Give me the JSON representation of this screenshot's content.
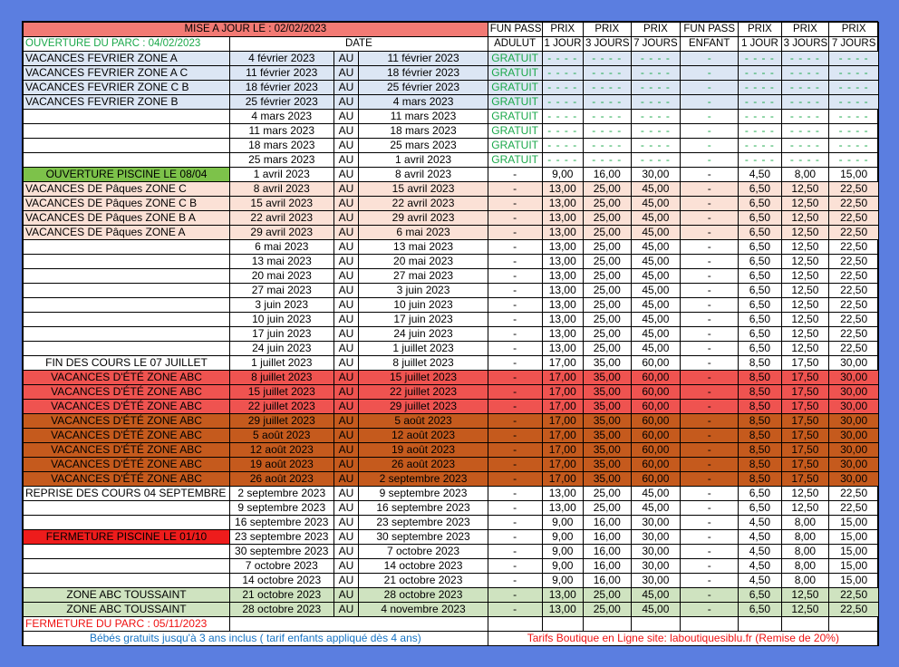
{
  "header": {
    "update_label": "MISE A JOUR LE : 02/02/2023",
    "opening_label": "OUVERTURE DU PARC : 04/02/2023",
    "date_label": "DATE",
    "cols": [
      {
        "top": "FUN PASS",
        "bottom": "ADULUT"
      },
      {
        "top": "PRIX",
        "bottom": "1 JOUR"
      },
      {
        "top": "PRIX",
        "bottom": "3 JOURS"
      },
      {
        "top": "PRIX",
        "bottom": "7 JOURS"
      },
      {
        "top": "FUN PASS",
        "bottom": "ENFANT"
      },
      {
        "top": "PRIX",
        "bottom": "1 JOUR"
      },
      {
        "top": "PRIX",
        "bottom": "3 JOURS"
      },
      {
        "top": "PRIX",
        "bottom": "7 JOURS"
      }
    ]
  },
  "rows": [
    {
      "label": "VACANCES FEVRIER ZONE A",
      "from": "4 février 2023",
      "au": "AU",
      "to": "11 février 2023",
      "fp_a": "GRATUIT",
      "a1": "- - - -",
      "a3": "- - - -",
      "a7": "- - - -",
      "fp_e": "-",
      "e1": "- - - -",
      "e3": "- - - -",
      "e7": "- - - -",
      "style": "lightblue"
    },
    {
      "label": "VACANCES FEVRIER ZONE A C",
      "from": "11 février 2023",
      "au": "AU",
      "to": "18 février 2023",
      "fp_a": "GRATUIT",
      "a1": "- - - -",
      "a3": "- - - -",
      "a7": "- - - -",
      "fp_e": "-",
      "e1": "- - - -",
      "e3": "- - - -",
      "e7": "- - - -",
      "style": "lightblue"
    },
    {
      "label": "VACANCES FEVRIER ZONE C B",
      "from": "18 février 2023",
      "au": "AU",
      "to": "25 février 2023",
      "fp_a": "GRATUIT",
      "a1": "- - - -",
      "a3": "- - - -",
      "a7": "- - - -",
      "fp_e": "-",
      "e1": "- - - -",
      "e3": "- - - -",
      "e7": "- - - -",
      "style": "lightblue"
    },
    {
      "label": "VACANCES FEVRIER ZONE B",
      "from": "25 février 2023",
      "au": "AU",
      "to": "4 mars 2023",
      "fp_a": "GRATUIT",
      "a1": "- - - -",
      "a3": "- - - -",
      "a7": "- - - -",
      "fp_e": "-",
      "e1": "- - - -",
      "e3": "- - - -",
      "e7": "- - - -",
      "style": "lightblue"
    },
    {
      "label": "",
      "from": "4 mars 2023",
      "au": "AU",
      "to": "11 mars 2023",
      "fp_a": "GRATUIT",
      "a1": "- - - -",
      "a3": "- - - -",
      "a7": "- - - -",
      "fp_e": "-",
      "e1": "- - - -",
      "e3": "- - - -",
      "e7": "- - - -",
      "style": "plain"
    },
    {
      "label": "",
      "from": "11 mars 2023",
      "au": "AU",
      "to": "18 mars 2023",
      "fp_a": "GRATUIT",
      "a1": "- - - -",
      "a3": "- - - -",
      "a7": "- - - -",
      "fp_e": "-",
      "e1": "- - - -",
      "e3": "- - - -",
      "e7": "- - - -",
      "style": "plain"
    },
    {
      "label": "",
      "from": "18 mars 2023",
      "au": "AU",
      "to": "25 mars 2023",
      "fp_a": "GRATUIT",
      "a1": "- - - -",
      "a3": "- - - -",
      "a7": "- - - -",
      "fp_e": "-",
      "e1": "- - - -",
      "e3": "- - - -",
      "e7": "- - - -",
      "style": "plain"
    },
    {
      "label": "",
      "from": "25 mars 2023",
      "au": "AU",
      "to": "1 avril 2023",
      "fp_a": "GRATUIT",
      "a1": "- - - -",
      "a3": "- - - -",
      "a7": "- - - -",
      "fp_e": "-",
      "e1": "- - - -",
      "e3": "- - - -",
      "e7": "- - - -",
      "style": "plain"
    },
    {
      "label": "OUVERTURE PISCINE LE 08/04",
      "from": "1 avril 2023",
      "au": "AU",
      "to": "8 avril 2023",
      "fp_a": "-",
      "a1": "9,00",
      "a3": "16,00",
      "a7": "30,00",
      "fp_e": "-",
      "e1": "4,50",
      "e3": "8,00",
      "e7": "15,00",
      "style": "plain",
      "label_style": "greenlabel"
    },
    {
      "label": "VACANCES DE Pâques ZONE C",
      "from": "8 avril 2023",
      "au": "AU",
      "to": "15 avril 2023",
      "fp_a": "-",
      "a1": "13,00",
      "a3": "25,00",
      "a7": "45,00",
      "fp_e": "-",
      "e1": "6,50",
      "e3": "12,50",
      "e7": "22,50",
      "style": "peach"
    },
    {
      "label": "VACANCES DE Pâques ZONE C B",
      "from": "15 avril 2023",
      "au": "AU",
      "to": "22 avril 2023",
      "fp_a": "-",
      "a1": "13,00",
      "a3": "25,00",
      "a7": "45,00",
      "fp_e": "-",
      "e1": "6,50",
      "e3": "12,50",
      "e7": "22,50",
      "style": "peach"
    },
    {
      "label": "VACANCES DE Pâques ZONE B A",
      "from": "22 avril 2023",
      "au": "AU",
      "to": "29 avril 2023",
      "fp_a": "-",
      "a1": "13,00",
      "a3": "25,00",
      "a7": "45,00",
      "fp_e": "-",
      "e1": "6,50",
      "e3": "12,50",
      "e7": "22,50",
      "style": "peach"
    },
    {
      "label": "VACANCES DE Pâques ZONE A",
      "from": "29 avril 2023",
      "au": "AU",
      "to": "6 mai 2023",
      "fp_a": "-",
      "a1": "13,00",
      "a3": "25,00",
      "a7": "45,00",
      "fp_e": "-",
      "e1": "6,50",
      "e3": "12,50",
      "e7": "22,50",
      "style": "peach"
    },
    {
      "label": "",
      "from": "6 mai 2023",
      "au": "AU",
      "to": "13 mai 2023",
      "fp_a": "-",
      "a1": "13,00",
      "a3": "25,00",
      "a7": "45,00",
      "fp_e": "-",
      "e1": "6,50",
      "e3": "12,50",
      "e7": "22,50",
      "style": "plain"
    },
    {
      "label": "",
      "from": "13 mai 2023",
      "au": "AU",
      "to": "20 mai 2023",
      "fp_a": "-",
      "a1": "13,00",
      "a3": "25,00",
      "a7": "45,00",
      "fp_e": "-",
      "e1": "6,50",
      "e3": "12,50",
      "e7": "22,50",
      "style": "plain"
    },
    {
      "label": "",
      "from": "20 mai 2023",
      "au": "AU",
      "to": "27 mai 2023",
      "fp_a": "-",
      "a1": "13,00",
      "a3": "25,00",
      "a7": "45,00",
      "fp_e": "-",
      "e1": "6,50",
      "e3": "12,50",
      "e7": "22,50",
      "style": "plain"
    },
    {
      "label": "",
      "from": "27 mai 2023",
      "au": "AU",
      "to": "3 juin 2023",
      "fp_a": "-",
      "a1": "13,00",
      "a3": "25,00",
      "a7": "45,00",
      "fp_e": "-",
      "e1": "6,50",
      "e3": "12,50",
      "e7": "22,50",
      "style": "plain"
    },
    {
      "label": "",
      "from": "3 juin 2023",
      "au": "AU",
      "to": "10 juin 2023",
      "fp_a": "-",
      "a1": "13,00",
      "a3": "25,00",
      "a7": "45,00",
      "fp_e": "-",
      "e1": "6,50",
      "e3": "12,50",
      "e7": "22,50",
      "style": "plain"
    },
    {
      "label": "",
      "from": "10 juin 2023",
      "au": "AU",
      "to": "17 juin 2023",
      "fp_a": "-",
      "a1": "13,00",
      "a3": "25,00",
      "a7": "45,00",
      "fp_e": "-",
      "e1": "6,50",
      "e3": "12,50",
      "e7": "22,50",
      "style": "plain"
    },
    {
      "label": "",
      "from": "17 juin 2023",
      "au": "AU",
      "to": "24 juin 2023",
      "fp_a": "-",
      "a1": "13,00",
      "a3": "25,00",
      "a7": "45,00",
      "fp_e": "-",
      "e1": "6,50",
      "e3": "12,50",
      "e7": "22,50",
      "style": "plain"
    },
    {
      "label": "",
      "from": "24 juin 2023",
      "au": "AU",
      "to": "1 juillet 2023",
      "fp_a": "-",
      "a1": "13,00",
      "a3": "25,00",
      "a7": "45,00",
      "fp_e": "-",
      "e1": "6,50",
      "e3": "12,50",
      "e7": "22,50",
      "style": "plain"
    },
    {
      "label": "FIN DES COURS LE 07 JUILLET",
      "from": "1 juillet 2023",
      "au": "AU",
      "to": "8 juillet 2023",
      "fp_a": "-",
      "a1": "17,00",
      "a3": "35,00",
      "a7": "60,00",
      "fp_e": "-",
      "e1": "8,50",
      "e3": "17,50",
      "e7": "30,00",
      "style": "plain",
      "label_center": true
    },
    {
      "label": "VACANCES D'ÉTÉ ZONE ABC",
      "from": "8 juillet 2023",
      "au": "AU",
      "to": "15 juillet 2023",
      "fp_a": "-",
      "a1": "17,00",
      "a3": "35,00",
      "a7": "60,00",
      "fp_e": "-",
      "e1": "8,50",
      "e3": "17,50",
      "e7": "30,00",
      "style": "red",
      "label_center": true
    },
    {
      "label": "VACANCES D'ÉTÉ ZONE ABC",
      "from": "15 juillet 2023",
      "au": "AU",
      "to": "22 juillet 2023",
      "fp_a": "-",
      "a1": "17,00",
      "a3": "35,00",
      "a7": "60,00",
      "fp_e": "-",
      "e1": "8,50",
      "e3": "17,50",
      "e7": "30,00",
      "style": "red",
      "label_center": true
    },
    {
      "label": "VACANCES D'ÉTÉ ZONE ABC",
      "from": "22 juillet 2023",
      "au": "AU",
      "to": "29 juillet 2023",
      "fp_a": "-",
      "a1": "17,00",
      "a3": "35,00",
      "a7": "60,00",
      "fp_e": "-",
      "e1": "8,50",
      "e3": "17,50",
      "e7": "30,00",
      "style": "red",
      "label_center": true
    },
    {
      "label": "VACANCES D'ÉTÉ ZONE ABC",
      "from": "29 juillet 2023",
      "au": "AU",
      "to": "5 août 2023",
      "fp_a": "-",
      "a1": "17,00",
      "a3": "35,00",
      "a7": "60,00",
      "fp_e": "-",
      "e1": "8,50",
      "e3": "17,50",
      "e7": "30,00",
      "style": "brown",
      "label_center": true
    },
    {
      "label": "VACANCES D'ÉTÉ ZONE ABC",
      "from": "5 août 2023",
      "au": "AU",
      "to": "12 août 2023",
      "fp_a": "-",
      "a1": "17,00",
      "a3": "35,00",
      "a7": "60,00",
      "fp_e": "-",
      "e1": "8,50",
      "e3": "17,50",
      "e7": "30,00",
      "style": "brown",
      "label_center": true
    },
    {
      "label": "VACANCES D'ÉTÉ ZONE ABC",
      "from": "12 août 2023",
      "au": "AU",
      "to": "19 août 2023",
      "fp_a": "-",
      "a1": "17,00",
      "a3": "35,00",
      "a7": "60,00",
      "fp_e": "-",
      "e1": "8,50",
      "e3": "17,50",
      "e7": "30,00",
      "style": "brown",
      "label_center": true
    },
    {
      "label": "VACANCES D'ÉTÉ ZONE ABC",
      "from": "19 août 2023",
      "au": "AU",
      "to": "26 août 2023",
      "fp_a": "-",
      "a1": "17,00",
      "a3": "35,00",
      "a7": "60,00",
      "fp_e": "-",
      "e1": "8,50",
      "e3": "17,50",
      "e7": "30,00",
      "style": "brown",
      "label_center": true
    },
    {
      "label": "VACANCES D'ÉTÉ ZONE ABC",
      "from": "26 août 2023",
      "au": "AU",
      "to": "2 septembre 2023",
      "fp_a": "-",
      "a1": "17,00",
      "a3": "35,00",
      "a7": "60,00",
      "fp_e": "-",
      "e1": "8,50",
      "e3": "17,50",
      "e7": "30,00",
      "style": "brown",
      "label_center": true
    },
    {
      "label": "REPRISE DES COURS 04 SEPTEMBRE",
      "from": "2 septembre 2023",
      "au": "AU",
      "to": "9 septembre 2023",
      "fp_a": "-",
      "a1": "13,00",
      "a3": "25,00",
      "a7": "45,00",
      "fp_e": "-",
      "e1": "6,50",
      "e3": "12,50",
      "e7": "22,50",
      "style": "plain"
    },
    {
      "label": "",
      "from": "9 septembre 2023",
      "au": "AU",
      "to": "16 septembre 2023",
      "fp_a": "-",
      "a1": "13,00",
      "a3": "25,00",
      "a7": "45,00",
      "fp_e": "-",
      "e1": "6,50",
      "e3": "12,50",
      "e7": "22,50",
      "style": "plain"
    },
    {
      "label": "",
      "from": "16 septembre 2023",
      "au": "AU",
      "to": "23 septembre 2023",
      "fp_a": "-",
      "a1": "9,00",
      "a3": "16,00",
      "a7": "30,00",
      "fp_e": "-",
      "e1": "4,50",
      "e3": "8,00",
      "e7": "15,00",
      "style": "plain"
    },
    {
      "label": "FERMETURE PISCINE LE 01/10",
      "from": "23 septembre 2023",
      "au": "AU",
      "to": "30 septembre 2023",
      "fp_a": "-",
      "a1": "9,00",
      "a3": "16,00",
      "a7": "30,00",
      "fp_e": "-",
      "e1": "4,50",
      "e3": "8,00",
      "e7": "15,00",
      "style": "plain",
      "label_style": "redlabel"
    },
    {
      "label": "",
      "from": "30 septembre 2023",
      "au": "AU",
      "to": "7 octobre 2023",
      "fp_a": "-",
      "a1": "9,00",
      "a3": "16,00",
      "a7": "30,00",
      "fp_e": "-",
      "e1": "4,50",
      "e3": "8,00",
      "e7": "15,00",
      "style": "plain"
    },
    {
      "label": "",
      "from": "7 octobre 2023",
      "au": "AU",
      "to": "14 octobre 2023",
      "fp_a": "-",
      "a1": "9,00",
      "a3": "16,00",
      "a7": "30,00",
      "fp_e": "-",
      "e1": "4,50",
      "e3": "8,00",
      "e7": "15,00",
      "style": "plain"
    },
    {
      "label": "",
      "from": "14 octobre 2023",
      "au": "AU",
      "to": "21 octobre 2023",
      "fp_a": "-",
      "a1": "9,00",
      "a3": "16,00",
      "a7": "30,00",
      "fp_e": "-",
      "e1": "4,50",
      "e3": "8,00",
      "e7": "15,00",
      "style": "plain"
    },
    {
      "label": "ZONE ABC TOUSSAINT",
      "from": "21 octobre 2023",
      "au": "AU",
      "to": "28 octobre 2023",
      "fp_a": "-",
      "a1": "13,00",
      "a3": "25,00",
      "a7": "45,00",
      "fp_e": "-",
      "e1": "6,50",
      "e3": "12,50",
      "e7": "22,50",
      "style": "lightgreen",
      "label_center": true
    },
    {
      "label": "ZONE ABC TOUSSAINT",
      "from": "28 octobre 2023",
      "au": "AU",
      "to": "4 novembre 2023",
      "fp_a": "-",
      "a1": "13,00",
      "a3": "25,00",
      "a7": "45,00",
      "fp_e": "-",
      "e1": "6,50",
      "e3": "12,50",
      "e7": "22,50",
      "style": "lightgreen",
      "label_center": true
    }
  ],
  "closing_label": "FERMETURE DU PARC : 05/11/2023",
  "footer": {
    "left": "Bébés gratuits jusqu'à 3 ans inclus ( tarif enfants appliqué dès 4 ans)",
    "right": "Tarifs Boutique en Ligne site: laboutiquesiblu.fr (Remise de 20%)"
  },
  "colors": {
    "page_bg": "#5b7ee0",
    "title_bg": "#f27a74",
    "free_text": "#1aa84a",
    "vacances_fevrier": "#dce6f4",
    "vacances_paques": "#fbe1d6",
    "ete_red": "#ef5350",
    "ete_brown": "#c55a1d",
    "toussaint": "#cfe3c0",
    "piscine_open": "#7dc24a",
    "piscine_close": "#ee1c1c"
  }
}
